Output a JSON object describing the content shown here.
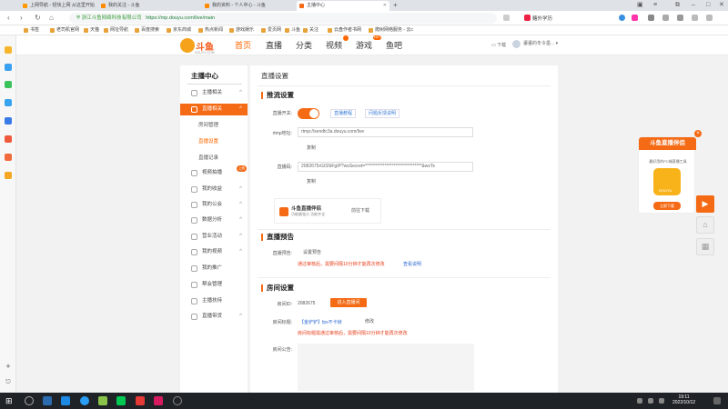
{
  "browser": {
    "tabs": [
      {
        "label": "上网导航 - 轻快上网 从这里开始",
        "active": false
      },
      {
        "label": "我的关注 - 斗鱼",
        "active": false
      },
      {
        "label": "我的资料 - 个人中心 - 斗鱼",
        "active": false
      },
      {
        "label": "主播中心",
        "active": true
      }
    ],
    "address": {
      "security_text": "浙江斗鱼网络科技有限公司",
      "url": "https://mp.douyu.com/live/main"
    },
    "search_text": "糖外学历",
    "bookmarks": [
      "书签",
      "老司机官网",
      "天猫",
      "网址导航",
      "百度搜索",
      "京东商城",
      "热点新闻",
      "游戏娱乐",
      "爱页网",
      "斗鱼",
      "关注",
      "云盘作者书网",
      "爬树网络服务 - 云c"
    ]
  },
  "site": {
    "logo_text": "斗鱼",
    "logo_sub": "DOUYU.COM",
    "nav": [
      {
        "label": "首页"
      },
      {
        "label": "直播"
      },
      {
        "label": "分类"
      },
      {
        "label": "视频"
      },
      {
        "label": "游戏",
        "badge": "HOT"
      },
      {
        "label": "鱼吧"
      }
    ],
    "download_label": "下载",
    "user_name": "鎏鎏的冬令墨..."
  },
  "left_nav": {
    "title": "主播中心",
    "items": [
      {
        "label": "主播相关",
        "caret": "^"
      },
      {
        "label": "直播相关",
        "caret": "^",
        "active": true
      },
      {
        "label": "视频拍播",
        "caret": "^",
        "badge": "上线"
      },
      {
        "label": "我的收益",
        "caret": "^"
      },
      {
        "label": "我的公会",
        "caret": "^"
      },
      {
        "label": "数据分析",
        "caret": "^"
      },
      {
        "label": "营业活动",
        "caret": "^"
      },
      {
        "label": "我的视频",
        "caret": "^"
      },
      {
        "label": "我的推广",
        "caret": ""
      },
      {
        "label": "帮会管理",
        "caret": ""
      },
      {
        "label": "主播扶持",
        "caret": ""
      },
      {
        "label": "直播带货",
        "caret": "^"
      }
    ],
    "subitems": [
      {
        "label": "房间管理",
        "selected": false
      },
      {
        "label": "直播设置",
        "selected": true
      },
      {
        "label": "直播记录",
        "selected": false
      }
    ]
  },
  "main": {
    "page_title": "直播设置",
    "push": {
      "heading": "推流设置",
      "switch_label": "直播开关:",
      "switch_on": true,
      "tutorial_link": "直播教程",
      "obs_link": "问题反馈说明",
      "rtmp_label": "rtmp地址:",
      "rtmp_value": "rtmp://sendtc3a.douyu.com/live",
      "copy_label": "复制",
      "code_label": "直播码:",
      "code_value": "2082675rG02bFgIP?wsSecret=********************************&wsTs",
      "copy_label2": "复制",
      "promo_title": "斗鱼直播伴侣",
      "promo_desc": "功能最强大 功能齐全",
      "promo_button": "前往下载"
    },
    "notice": {
      "heading": "直播预告",
      "label": "直播预告:",
      "button": "设置预告",
      "warning": "通过审核后，需要间隔10分钟才能再次修改",
      "link": "查看说明"
    },
    "room": {
      "heading": "房间设置",
      "id_label": "房间ID:",
      "id_value": "2082675",
      "enter_button": "进入直播间",
      "title_label": "房间标题:",
      "title_value": "【金铲铲】fps不卡帧",
      "edit_button": "修改",
      "title_warning": "房间标题需通过审核后，需要间隔10分钟才能再次修改",
      "announce_label": "房间公告:"
    }
  },
  "float_ad": {
    "title": "斗鱼直播伴侣",
    "desc": "最好用的PC端直播工具",
    "app_label": "DOUYU",
    "download": "立即下载"
  },
  "taskbar": {
    "time": "19:11",
    "date": "2022/10/12"
  },
  "colors": {
    "accent": "#f46a15",
    "link": "#2f6bd0",
    "warning": "#e8401c"
  }
}
